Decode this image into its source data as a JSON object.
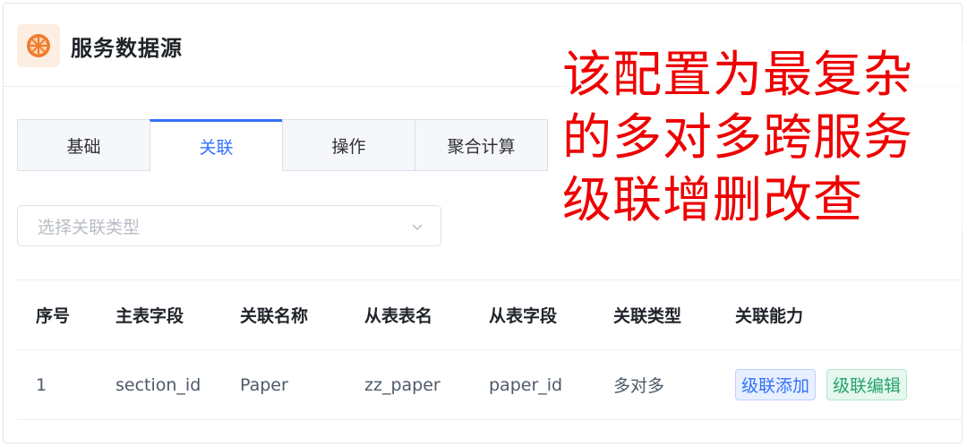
{
  "header": {
    "title": "服务数据源",
    "icon": "orange-slice-icon",
    "icon_color": "#f07b30"
  },
  "tabs": [
    {
      "label": "基础",
      "active": false
    },
    {
      "label": "关联",
      "active": true
    },
    {
      "label": "操作",
      "active": false
    },
    {
      "label": "聚合计算",
      "active": false
    }
  ],
  "relation_select": {
    "placeholder": "选择关联类型"
  },
  "table": {
    "columns": [
      "序号",
      "主表字段",
      "关联名称",
      "从表表名",
      "从表字段",
      "关联类型",
      "关联能力"
    ],
    "rows": [
      {
        "index": "1",
        "main_field": "section_id",
        "relation_name": "Paper",
        "sub_table": "zz_paper",
        "sub_field": "paper_id",
        "relation_type": "多对多",
        "capabilities": [
          "级联添加",
          "级联编辑"
        ]
      }
    ]
  },
  "annotation": {
    "lines": [
      "该配置为最复杂",
      "的多对多跨服务",
      "级联增删改查"
    ],
    "color": "#ee0000"
  },
  "colors": {
    "accent": "#3370ff",
    "tag_blue": "#3370ff",
    "tag_green": "#24a36b"
  }
}
